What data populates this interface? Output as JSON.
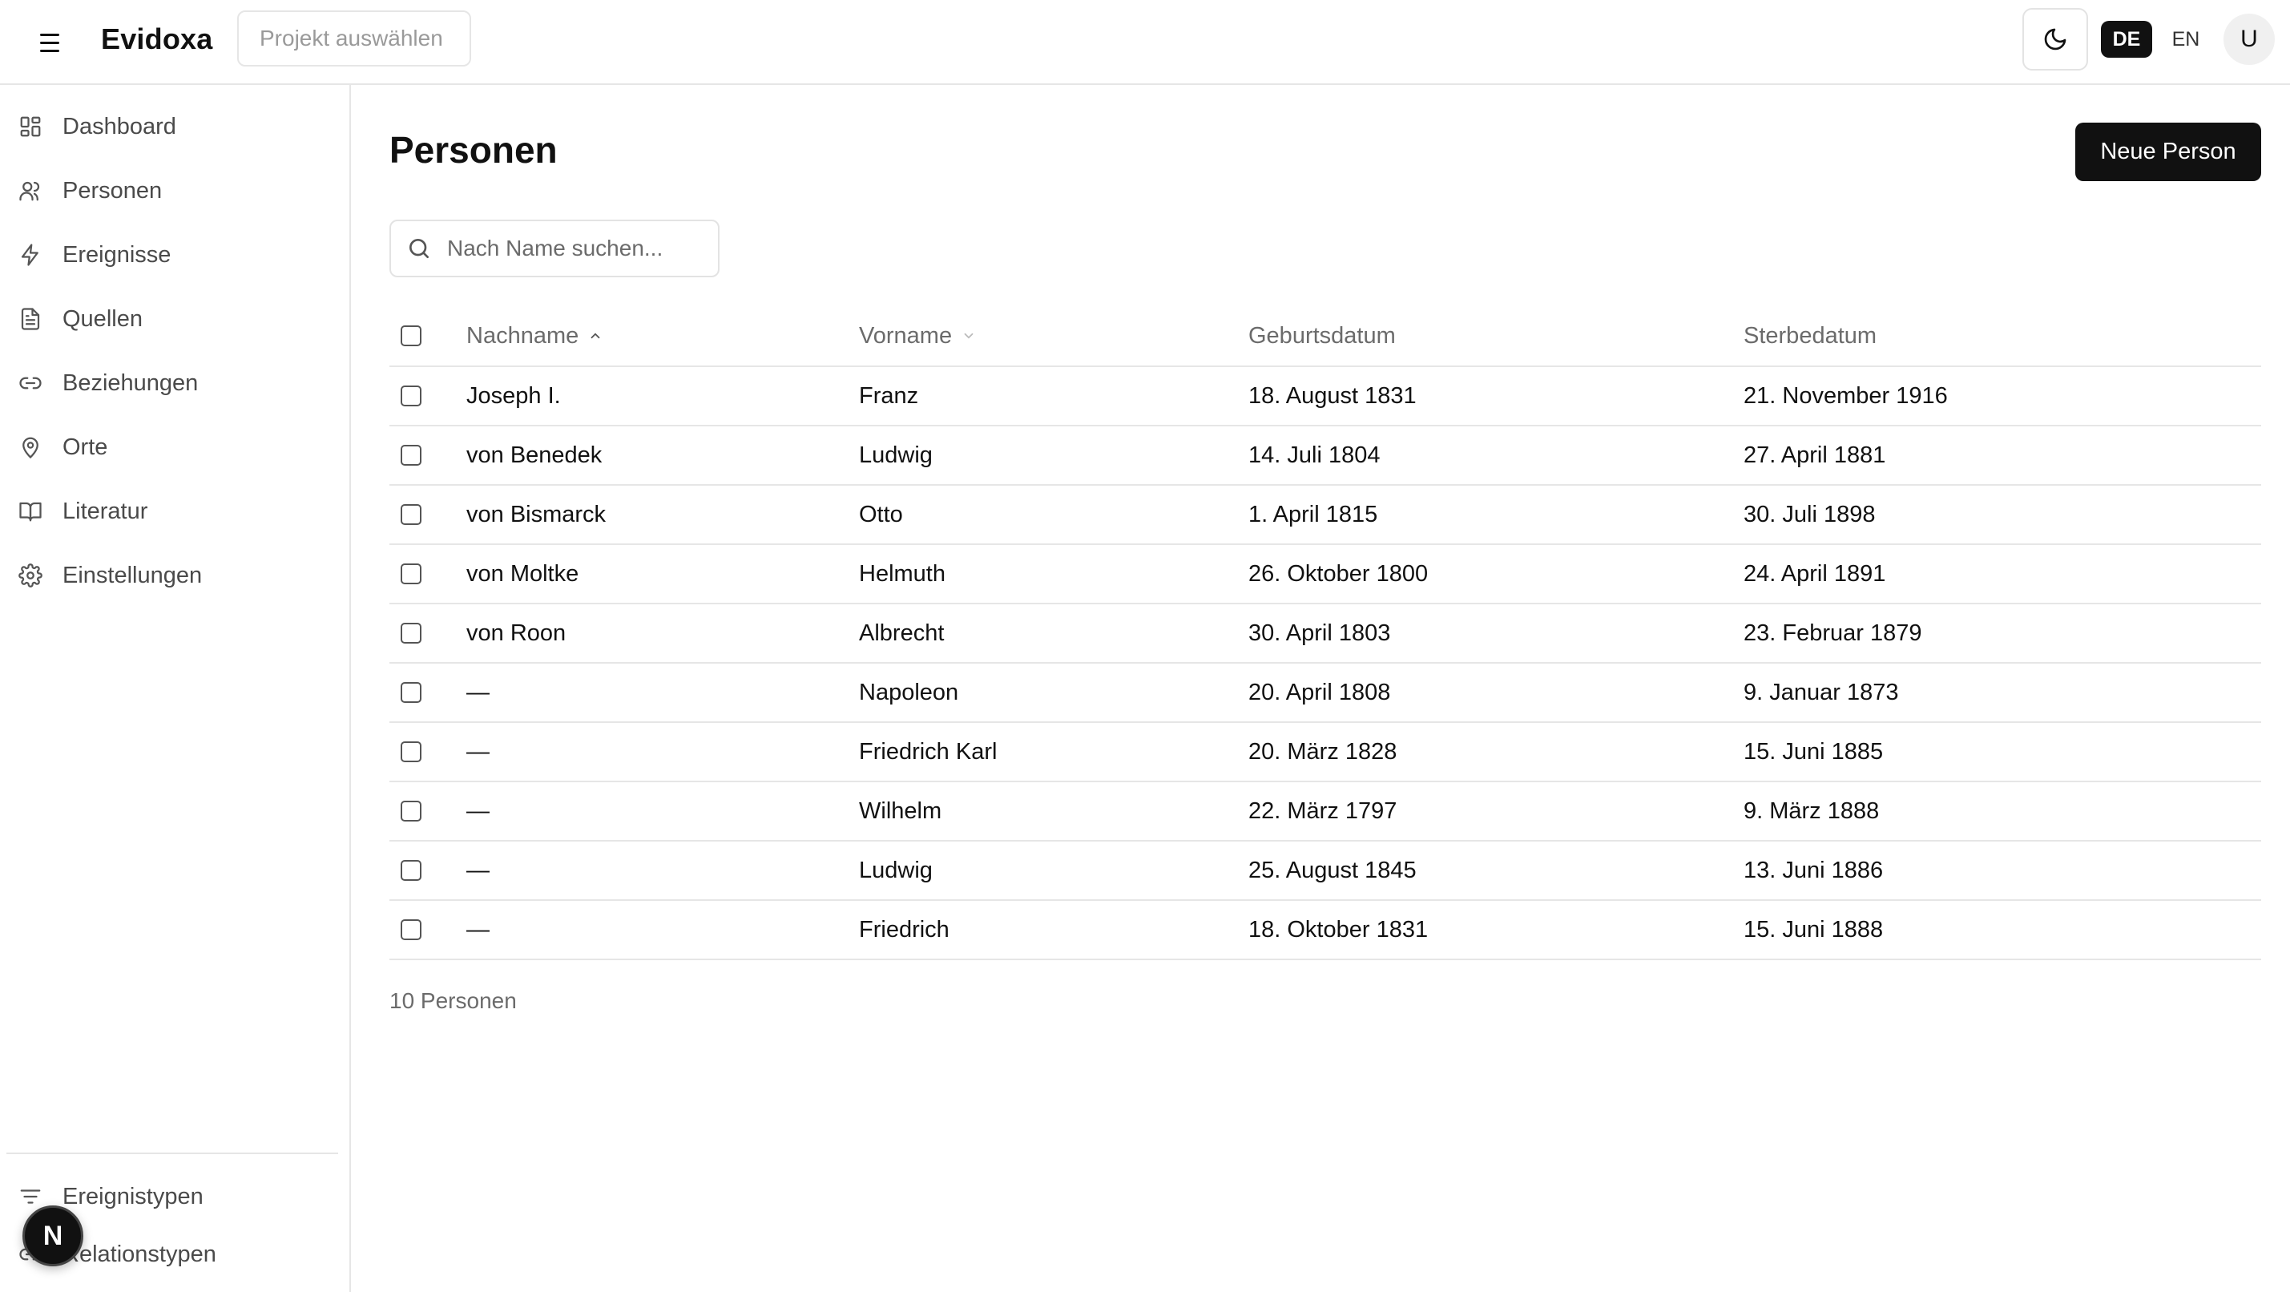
{
  "header": {
    "brand": "Evidoxa",
    "project_placeholder": "Projekt auswählen",
    "lang_de": "DE",
    "lang_en": "EN",
    "avatar_initial": "U"
  },
  "sidebar": {
    "items": [
      {
        "label": "Dashboard",
        "icon": "dashboard-icon"
      },
      {
        "label": "Personen",
        "icon": "users-icon"
      },
      {
        "label": "Ereignisse",
        "icon": "lightning-icon"
      },
      {
        "label": "Quellen",
        "icon": "document-icon"
      },
      {
        "label": "Beziehungen",
        "icon": "link-icon"
      },
      {
        "label": "Orte",
        "icon": "map-pin-icon"
      },
      {
        "label": "Literatur",
        "icon": "book-icon"
      },
      {
        "label": "Einstellungen",
        "icon": "gear-icon"
      }
    ],
    "bottom_items": [
      {
        "label": "Ereignistypen",
        "icon": "filter-icon"
      },
      {
        "label": "Relationstypen",
        "icon": "link-icon"
      }
    ],
    "badge_letter": "N"
  },
  "main": {
    "title": "Personen",
    "new_button": "Neue Person",
    "search_placeholder": "Nach Name suchen...",
    "columns": [
      "Nachname",
      "Vorname",
      "Geburtsdatum",
      "Sterbedatum"
    ],
    "rows": [
      {
        "nachname": "Joseph I.",
        "vorname": "Franz",
        "geburt": "18. August 1831",
        "tod": "21. November 1916"
      },
      {
        "nachname": "von Benedek",
        "vorname": "Ludwig",
        "geburt": "14. Juli 1804",
        "tod": "27. April 1881"
      },
      {
        "nachname": "von Bismarck",
        "vorname": "Otto",
        "geburt": "1. April 1815",
        "tod": "30. Juli 1898"
      },
      {
        "nachname": "von Moltke",
        "vorname": "Helmuth",
        "geburt": "26. Oktober 1800",
        "tod": "24. April 1891"
      },
      {
        "nachname": "von Roon",
        "vorname": "Albrecht",
        "geburt": "30. April 1803",
        "tod": "23. Februar 1879"
      },
      {
        "nachname": "—",
        "vorname": "Napoleon",
        "geburt": "20. April 1808",
        "tod": "9. Januar 1873"
      },
      {
        "nachname": "—",
        "vorname": "Friedrich Karl",
        "geburt": "20. März 1828",
        "tod": "15. Juni 1885"
      },
      {
        "nachname": "—",
        "vorname": "Wilhelm",
        "geburt": "22. März 1797",
        "tod": "9. März 1888"
      },
      {
        "nachname": "—",
        "vorname": "Ludwig",
        "geburt": "25. August 1845",
        "tod": "13. Juni 1886"
      },
      {
        "nachname": "—",
        "vorname": "Friedrich",
        "geburt": "18. Oktober 1831",
        "tod": "15. Juni 1888"
      }
    ],
    "count_label": "10 Personen"
  }
}
